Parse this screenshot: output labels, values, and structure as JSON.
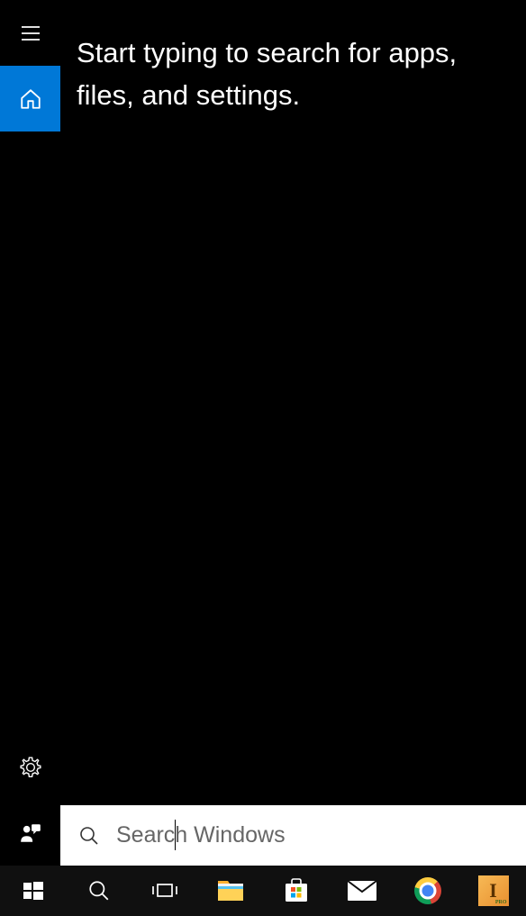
{
  "main": {
    "prompt": "Start typing to search for apps, files, and settings."
  },
  "search": {
    "placeholder": "Search Windows",
    "value": ""
  },
  "sidebar": {
    "items": [
      {
        "name": "hamburger",
        "active": false
      },
      {
        "name": "home",
        "active": true
      }
    ],
    "bottom_items": [
      {
        "name": "settings"
      },
      {
        "name": "feedback"
      }
    ]
  },
  "taskbar": {
    "items": [
      {
        "name": "start"
      },
      {
        "name": "search"
      },
      {
        "name": "task-view"
      },
      {
        "name": "file-explorer"
      },
      {
        "name": "store"
      },
      {
        "name": "mail"
      },
      {
        "name": "chrome"
      },
      {
        "name": "inventor"
      }
    ]
  },
  "inventor_badge": "PRO"
}
